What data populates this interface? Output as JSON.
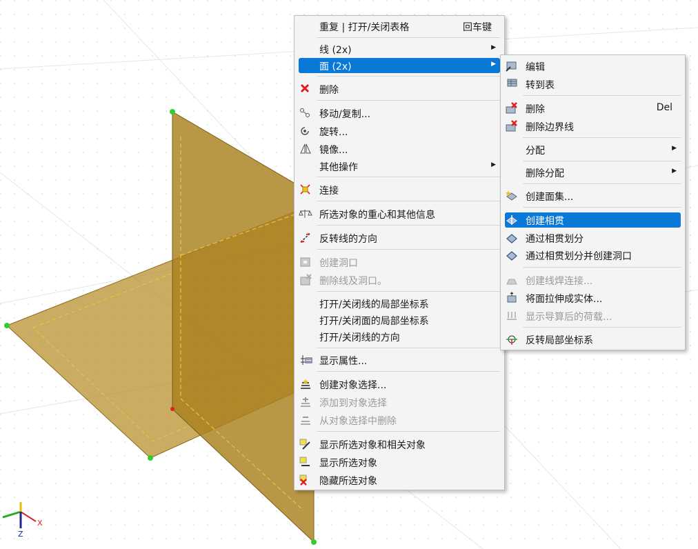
{
  "axes": {
    "x": "X",
    "z": "Z"
  },
  "context_menu": {
    "items": [
      {
        "label": "重复 | 打开/关闭表格",
        "shortcut": "回车键",
        "icon": ""
      },
      {
        "label": "线 (2x)",
        "submenu": true
      },
      {
        "label": "面 (2x)",
        "submenu": true,
        "highlighted": true
      },
      {
        "label": "删除",
        "icon": "delete-icon"
      },
      {
        "label": "移动/复制...",
        "icon": "move-copy-icon"
      },
      {
        "label": "旋转...",
        "icon": "rotate-icon"
      },
      {
        "label": "镜像...",
        "icon": "mirror-icon"
      },
      {
        "label": "其他操作",
        "submenu": true
      },
      {
        "label": "连接",
        "icon": "connect-icon"
      },
      {
        "label": "所选对象的重心和其他信息",
        "icon": "centroid-info-icon"
      },
      {
        "label": "反转线的方向",
        "icon": "reverse-line-icon"
      },
      {
        "label": "创建洞口",
        "disabled": true,
        "icon": "create-opening-icon"
      },
      {
        "label": "删除线及洞口。",
        "disabled": true,
        "icon": "delete-line-opening-icon"
      },
      {
        "label": "打开/关闭线的局部坐标系"
      },
      {
        "label": "打开/关闭面的局部坐标系"
      },
      {
        "label": "打开/关闭线的方向"
      },
      {
        "label": "显示属性...",
        "icon": "show-properties-icon"
      },
      {
        "label": "创建对象选择...",
        "icon": "create-selection-icon"
      },
      {
        "label": "添加到对象选择",
        "disabled": true,
        "icon": "add-selection-icon"
      },
      {
        "label": "从对象选择中删除",
        "disabled": true,
        "icon": "remove-selection-icon"
      },
      {
        "label": "显示所选对象和相关对象",
        "icon": "show-related-icon"
      },
      {
        "label": "显示所选对象",
        "icon": "show-selected-icon"
      },
      {
        "label": "隐藏所选对象",
        "icon": "hide-selected-icon"
      }
    ]
  },
  "submenu": {
    "items": [
      {
        "label": "编辑",
        "icon": "edit-icon"
      },
      {
        "label": "转到表",
        "icon": "goto-table-icon"
      },
      {
        "label": "删除",
        "shortcut": "Del",
        "icon": "delete-surface-icon"
      },
      {
        "label": "删除边界线",
        "icon": "delete-boundary-icon"
      },
      {
        "label": "分配",
        "submenu": true
      },
      {
        "label": "删除分配",
        "submenu": true
      },
      {
        "label": "创建面集...",
        "icon": "create-surface-set-icon"
      },
      {
        "label": "创建相贯",
        "highlighted": true,
        "icon": "create-intersection-icon"
      },
      {
        "label": "通过相贯划分",
        "icon": "split-intersection-icon"
      },
      {
        "label": "通过相贯划分并创建洞口",
        "icon": "split-opening-icon"
      },
      {
        "label": "创建线焊连接...",
        "disabled": true,
        "icon": "weld-icon"
      },
      {
        "label": "将面拉伸成实体...",
        "icon": "extrude-icon"
      },
      {
        "label": "显示导算后的荷载...",
        "disabled": true,
        "icon": "loads-icon"
      },
      {
        "label": "反转局部坐标系",
        "icon": "reverse-lcs-icon"
      }
    ]
  }
}
